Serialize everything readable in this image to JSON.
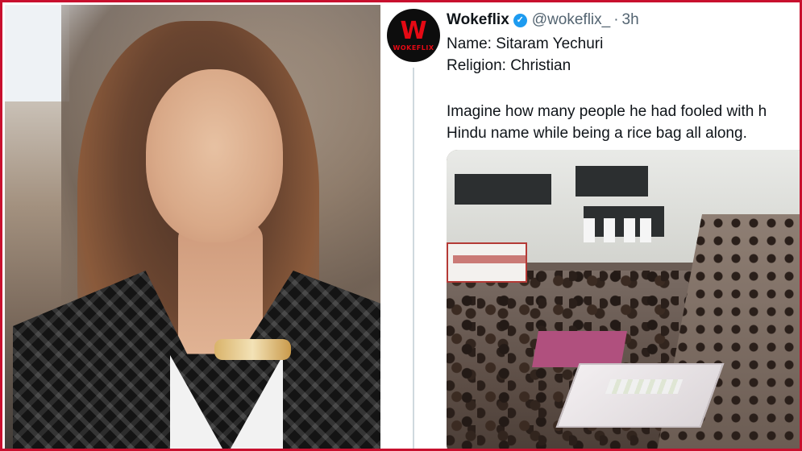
{
  "tweet": {
    "avatar": {
      "letter": "W",
      "wordmark": "WOKEFLIX",
      "brand_color": "#e50914",
      "background": "#0d0d0d"
    },
    "display_name": "Wokeflix",
    "verified_icon": "verified-badge-icon",
    "verified_glyph": "✓",
    "handle": "@wokeflix_",
    "separator": "·",
    "time": "3h",
    "lines": [
      "Name: Sitaram Yechuri",
      "Religion: Christian",
      "Imagine how many people he had fooled with h",
      "Hindu name while being a rice bag all along."
    ],
    "media": "crowd-photo"
  },
  "colors": {
    "frame_border": "#c8102e",
    "verified_blue": "#1d9bf0",
    "text_primary": "#0f1419",
    "text_secondary": "#536471"
  },
  "left_photo": "portrait-photo"
}
